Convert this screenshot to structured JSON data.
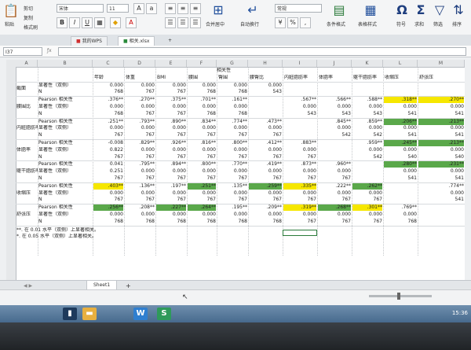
{
  "ribbon": {
    "font_name": "宋体",
    "font_size": "11",
    "number_format": "常规",
    "paste": "粘贴",
    "cut": "剪切",
    "copy": "复制",
    "format_painter": "格式刷",
    "merge_center": "合并居中",
    "wrap_text": "自动换行",
    "conditional_format": "条件格式",
    "table_style": "表格样式",
    "symbol": "符号",
    "sum": "求和",
    "filter": "筛选",
    "sort": "排序"
  },
  "tabs": {
    "wps": "我的WPS",
    "file": "相关.xlsx"
  },
  "formula_bar": {
    "name_box": "I37"
  },
  "columns": [
    "A",
    "B",
    "C",
    "D",
    "E",
    "F",
    "G",
    "H",
    "I",
    "J",
    "K",
    "L",
    "M"
  ],
  "header": {
    "merged_title": "相关性",
    "cols": [
      "年龄",
      "体重",
      "BMI",
      "腰围",
      "臀围",
      "腰臀比",
      "内脏脂肪率",
      "体脂率",
      "躯干脂肪率",
      "收缩压",
      "舒张压"
    ]
  },
  "row_labels": [
    "截面",
    "腰围比",
    "内脏脂肪率",
    "体脂率",
    "躯干脂肪率",
    "收缩压",
    "舒张压"
  ],
  "sub_labels": {
    "pearson": "Pearson 相关性",
    "sig": "显著性（双侧）",
    "n": "N"
  },
  "blocks": [
    {
      "pearson": [],
      "sig": [
        "0.000",
        "0.000",
        "0.000",
        "0.000",
        "0.000",
        "0.000"
      ],
      "n": [
        "768",
        "767",
        "767",
        "768",
        "768",
        "543"
      ]
    },
    {
      "pearson": [
        ".376**",
        ".270**",
        ".375**",
        ".701**",
        ".161**",
        "",
        ".567**",
        ".566**",
        ".588**",
        ".318**",
        ".270**"
      ],
      "sig": [
        "0.000",
        "0.000",
        "0.000",
        "0.000",
        "0.000",
        "",
        "0.000",
        "0.000",
        "0.000",
        "0.000",
        "0.000"
      ],
      "n": [
        "768",
        "767",
        "767",
        "768",
        "768",
        "",
        "543",
        "543",
        "543",
        "541",
        "541"
      ]
    },
    {
      "pearson": [
        ".251**",
        ".793**",
        ".890**",
        ".834**",
        ".774**",
        ".473**",
        "",
        ".845**",
        ".859**",
        ".206**",
        ".213**"
      ],
      "sig": [
        "0.000",
        "0.000",
        "0.000",
        "0.000",
        "0.000",
        "0.000",
        "",
        "0.000",
        "0.000",
        "0.000",
        "0.000"
      ],
      "n": [
        "767",
        "767",
        "767",
        "767",
        "767",
        "767",
        "",
        "542",
        "542",
        "541",
        "541"
      ]
    },
    {
      "pearson": [
        "-0.008",
        ".829**",
        ".926**",
        ".816**",
        ".800**",
        ".412**",
        ".883**",
        "",
        ".959**",
        ".245**",
        ".213**"
      ],
      "sig": [
        "0.822",
        "0.000",
        "0.000",
        "0.000",
        "0.000",
        "0.000",
        "0.000",
        "",
        "0.000",
        "0.000",
        "0.000"
      ],
      "n": [
        "767",
        "767",
        "767",
        "767",
        "767",
        "767",
        "767",
        "",
        "542",
        "540",
        "540"
      ]
    },
    {
      "pearson": [
        "0.041",
        ".795**",
        ".894**",
        ".800**",
        ".770**",
        ".419**",
        ".873**",
        ".960**",
        "",
        ".280**",
        ".231**"
      ],
      "sig": [
        "0.251",
        "0.000",
        "0.000",
        "0.000",
        "0.000",
        "0.000",
        "0.000",
        "0.000",
        "",
        "0.000",
        "0.000"
      ],
      "n": [
        "767",
        "767",
        "767",
        "767",
        "767",
        "767",
        "767",
        "767",
        "",
        "541",
        "541"
      ]
    },
    {
      "pearson": [
        ".403**",
        ".136**",
        ".197**",
        ".251**",
        ".135**",
        ".259**",
        ".335**",
        ".222**",
        ".262**",
        "",
        ".774**"
      ],
      "sig": [
        "0.000",
        "0.000",
        "0.000",
        "0.000",
        "0.000",
        "0.000",
        "0.000",
        "0.000",
        "0.000",
        "",
        "0.000"
      ],
      "n": [
        "767",
        "767",
        "767",
        "767",
        "767",
        "767",
        "767",
        "767",
        "767",
        "",
        "541"
      ]
    },
    {
      "pearson": [
        ".256**",
        ".208**",
        ".227**",
        ".264**",
        ".195**",
        ".209**",
        ".319**",
        ".268**",
        ".301**",
        ".769**",
        ""
      ],
      "sig": [
        "0.000",
        "0.000",
        "0.000",
        "0.000",
        "0.000",
        "0.000",
        "0.000",
        "0.000",
        "0.000",
        "0.000",
        ""
      ],
      "n": [
        "768",
        "768",
        "768",
        "768",
        "768",
        "768",
        "767",
        "767",
        "767",
        "768",
        ""
      ]
    }
  ],
  "highlights": {
    "yellow": [
      "1-9",
      "1-10",
      "5-0",
      "5-6",
      "6-6",
      "6-8"
    ],
    "green": [
      "2-9",
      "2-10",
      "3-9",
      "3-10",
      "4-9",
      "4-10",
      "5-3",
      "5-5",
      "5-8",
      "6-0",
      "6-2",
      "6-3",
      "6-7"
    ]
  },
  "footnotes": [
    "**. 在 0.01 水平（双侧）上显著相关。",
    "*. 在 0.05 水平（双侧）上显著相关。"
  ],
  "sheet_tab": "Sheet1",
  "taskbar": {
    "clock": "15:36"
  }
}
